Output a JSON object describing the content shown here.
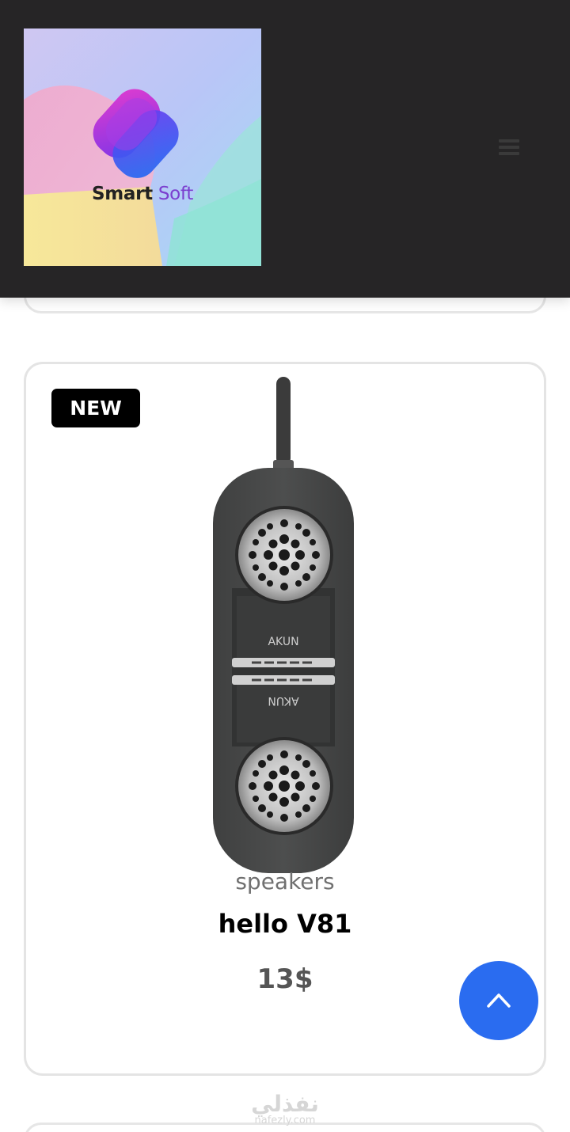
{
  "header": {
    "logo": {
      "word1": "Smart",
      "word2": "Soft",
      "icon": "smart-soft-logo-icon"
    },
    "menu_icon": "hamburger-menu-icon"
  },
  "product": {
    "badge": "NEW",
    "image_icon": "portable-speaker-image",
    "category": "speakers",
    "name": "hello V81",
    "price": "13$"
  },
  "scroll_top_icon": "chevron-up-icon",
  "watermark": {
    "arabic": "نفذلي",
    "latin": "nafezly.com"
  },
  "colors": {
    "header_bg": "#262526",
    "accent": "#2a6cf0",
    "badge_bg": "#000000"
  }
}
